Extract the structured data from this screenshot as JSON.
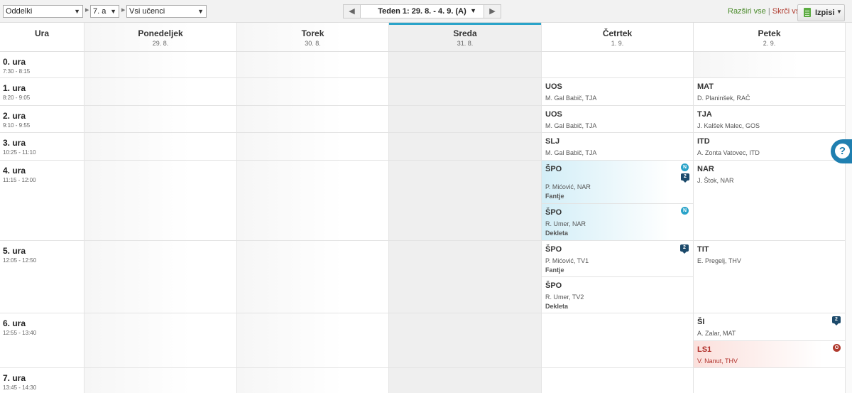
{
  "toolbar": {
    "filter_type": "Oddelki",
    "class": "7. a",
    "students": "Vsi učenci",
    "week_label": "Teden 1: 29. 8. - 4. 9. (A)",
    "expand_all": "Razširi vse",
    "separator": "|",
    "collapse_all": "Skrči vse",
    "print_label": "Izpisi"
  },
  "colors": {
    "accent": "#2aa3c9",
    "substitution": "#d3eef7",
    "cancelled": "#b03a2e",
    "print_icon": "#5aab3f",
    "help": "#1f7fb0"
  },
  "columns": {
    "hour_header": "Ura",
    "days": [
      {
        "name": "Ponedeljek",
        "date": "29. 8."
      },
      {
        "name": "Torek",
        "date": "30. 8."
      },
      {
        "name": "Sreda",
        "date": "31. 8."
      },
      {
        "name": "Četrtek",
        "date": "1. 9."
      },
      {
        "name": "Petek",
        "date": "2. 9."
      }
    ]
  },
  "hours": [
    {
      "name": "0. ura",
      "time": "7:30 - 8:15"
    },
    {
      "name": "1. ura",
      "time": "8:20 - 9:05"
    },
    {
      "name": "2. ura",
      "time": "9:10 - 9:55"
    },
    {
      "name": "3. ura",
      "time": "10:25 - 11:10"
    },
    {
      "name": "4. ura",
      "time": "11:15 - 12:00"
    },
    {
      "name": "5. ura",
      "time": "12:05 - 12:50"
    },
    {
      "name": "6. ura",
      "time": "12:55 - 13:40"
    },
    {
      "name": "7. ura",
      "time": "13:45 - 14:30"
    }
  ],
  "lessons": {
    "thu_1": {
      "subject": "UOS",
      "teacher": "M. Gal Babič, TJA"
    },
    "thu_2": {
      "subject": "UOS",
      "teacher": "M. Gal Babič, TJA"
    },
    "thu_3": {
      "subject": "SLJ",
      "teacher": "M. Gal Babič, TJA"
    },
    "thu_4a": {
      "subject": "ŠPO",
      "teacher": "P. Mićović, NAR",
      "group": "Fantje",
      "badge": "N",
      "comments": "2"
    },
    "thu_4b": {
      "subject": "ŠPO",
      "teacher": "R. Umer, NAR",
      "group": "Dekleta",
      "badge": "N"
    },
    "thu_5a": {
      "subject": "ŠPO",
      "teacher": "P. Mićović, TV1",
      "group": "Fantje",
      "comments": "2"
    },
    "thu_5b": {
      "subject": "ŠPO",
      "teacher": "R. Umer, TV2",
      "group": "Dekleta"
    },
    "fri_1": {
      "subject": "MAT",
      "teacher": "D. Planinšek, RAČ"
    },
    "fri_2": {
      "subject": "TJA",
      "teacher": "J. Kalšek Malec, GOS"
    },
    "fri_3": {
      "subject": "ITD",
      "teacher": "A. Zonta Vatovec, ITD"
    },
    "fri_4": {
      "subject": "NAR",
      "teacher": "J. Štok, NAR"
    },
    "fri_5": {
      "subject": "TIT",
      "teacher": "E. Pregelj, THV"
    },
    "fri_6a": {
      "subject": "ŠI",
      "teacher": "A. Zalar, MAT",
      "comments": "2"
    },
    "fri_6b": {
      "subject": "LS1",
      "teacher": "V. Nanut, THV",
      "badge": "O"
    }
  },
  "help_symbol": "?"
}
